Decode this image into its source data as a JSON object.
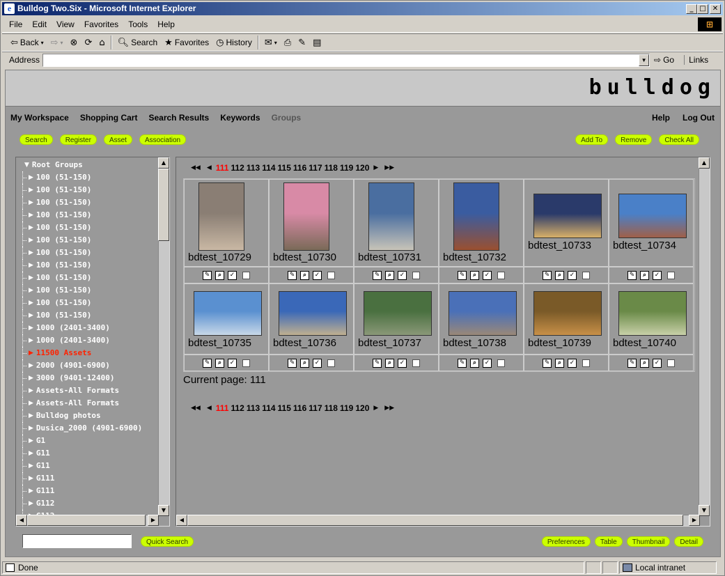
{
  "window": {
    "title": "Bulldog Two.Six - Microsoft Internet Explorer",
    "buttons": [
      "_",
      "□",
      "✕"
    ]
  },
  "menu": [
    "File",
    "Edit",
    "View",
    "Favorites",
    "Tools",
    "Help"
  ],
  "toolbar": {
    "back": "Back",
    "search": "Search",
    "favorites": "Favorites",
    "history": "History"
  },
  "address": {
    "label": "Address",
    "value": "",
    "go": "Go",
    "links": "Links"
  },
  "header": {
    "logo": "bulldog"
  },
  "nav": {
    "left": [
      "My Workspace",
      "Shopping Cart",
      "Search Results",
      "Keywords",
      "Groups"
    ],
    "right": [
      "Help",
      "Log Out"
    ]
  },
  "actions_left": [
    "Search",
    "Register",
    "Asset",
    "Association"
  ],
  "actions_right": [
    "Add To",
    "Remove",
    "Check All"
  ],
  "tree": {
    "root": "Root Groups",
    "items": [
      "100 (51-150)",
      "100 (51-150)",
      "100 (51-150)",
      "100 (51-150)",
      "100 (51-150)",
      "100 (51-150)",
      "100 (51-150)",
      "100 (51-150)",
      "100 (51-150)",
      "100 (51-150)",
      "100 (51-150)",
      "100 (51-150)",
      "1000 (2401-3400)",
      "1000 (2401-3400)",
      "11500 Assets",
      "2000 (4901-6900)",
      "3000 (9401-12400)",
      "Assets-All Formats",
      "Assets-All Formats",
      "Bulldog photos",
      "Dusica_2000 (4901-6900)",
      "G1",
      "G11",
      "G11",
      "G111",
      "G111",
      "G112",
      "G112"
    ],
    "selected_index": 14
  },
  "pager": {
    "first": "◀◀",
    "prev": "◀",
    "next": "▶",
    "last": "▶▶",
    "pages": [
      "111",
      "112",
      "113",
      "114",
      "115",
      "116",
      "117",
      "118",
      "119",
      "120"
    ],
    "current": "111"
  },
  "assets": [
    {
      "name": "bdtest_10729",
      "colors": [
        "#8a7e74",
        "#c9b8a4"
      ]
    },
    {
      "name": "bdtest_10730",
      "colors": [
        "#d88aa6",
        "#7a6a58"
      ]
    },
    {
      "name": "bdtest_10731",
      "colors": [
        "#4a6ea0",
        "#c8c4b8"
      ]
    },
    {
      "name": "bdtest_10732",
      "colors": [
        "#3a5ca0",
        "#9a5030"
      ]
    },
    {
      "name": "bdtest_10733",
      "colors": [
        "#2a3a6a",
        "#d8b068"
      ]
    },
    {
      "name": "bdtest_10734",
      "colors": [
        "#4a80c8",
        "#a06048"
      ]
    },
    {
      "name": "bdtest_10735",
      "colors": [
        "#5a90d0",
        "#c8d8e8"
      ]
    },
    {
      "name": "bdtest_10736",
      "colors": [
        "#3a68b8",
        "#c0b090"
      ]
    },
    {
      "name": "bdtest_10737",
      "colors": [
        "#4a7040",
        "#8a9878"
      ]
    },
    {
      "name": "bdtest_10738",
      "colors": [
        "#4a70b8",
        "#9a8878"
      ]
    },
    {
      "name": "bdtest_10739",
      "colors": [
        "#7a5a28",
        "#c89048"
      ]
    },
    {
      "name": "bdtest_10740",
      "colors": [
        "#6a8a48",
        "#c8d0a8"
      ]
    }
  ],
  "current_page_text": "Current page: 111",
  "footer": {
    "quick_search": "Quick Search",
    "buttons": [
      "Preferences",
      "Table",
      "Thumbnail",
      "Detail"
    ]
  },
  "status": {
    "text": "Done",
    "zone": "Local intranet"
  }
}
